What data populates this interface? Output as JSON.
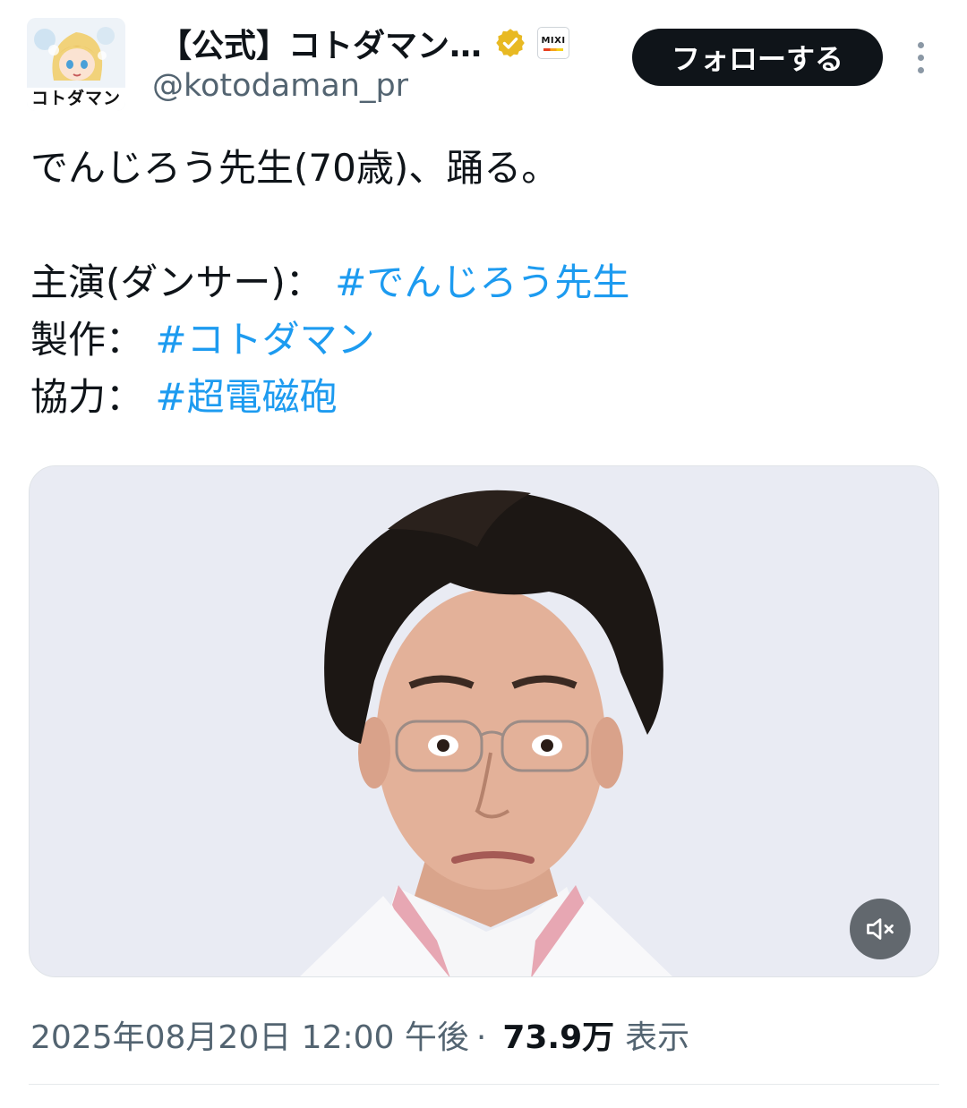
{
  "account": {
    "display_name": "【公式】コトダマン…",
    "handle": "@kotodaman_pr",
    "avatar_logo_text": "コトダマン",
    "verified_color": "#e8b923"
  },
  "actions": {
    "follow_label": "フォローする",
    "more_icon": "more-vertical-icon"
  },
  "tweet": {
    "line1": "でんじろう先生(70歳)、踊る。",
    "line2_prefix": "主演(ダンサー)：",
    "line2_tag": "#でんじろう先生",
    "line3_prefix": "製作：",
    "line3_tag": "#コトダマン",
    "line4_prefix": "協力：",
    "line4_tag": "#超電磁砲",
    "hashtag_color": "#1d9bf0"
  },
  "media": {
    "type": "video",
    "mute_icon": "volume-muted-icon"
  },
  "meta": {
    "timestamp": "2025年08月20日 12:00 午後",
    "separator": "·",
    "views": "73.9万",
    "views_label": "表示"
  }
}
